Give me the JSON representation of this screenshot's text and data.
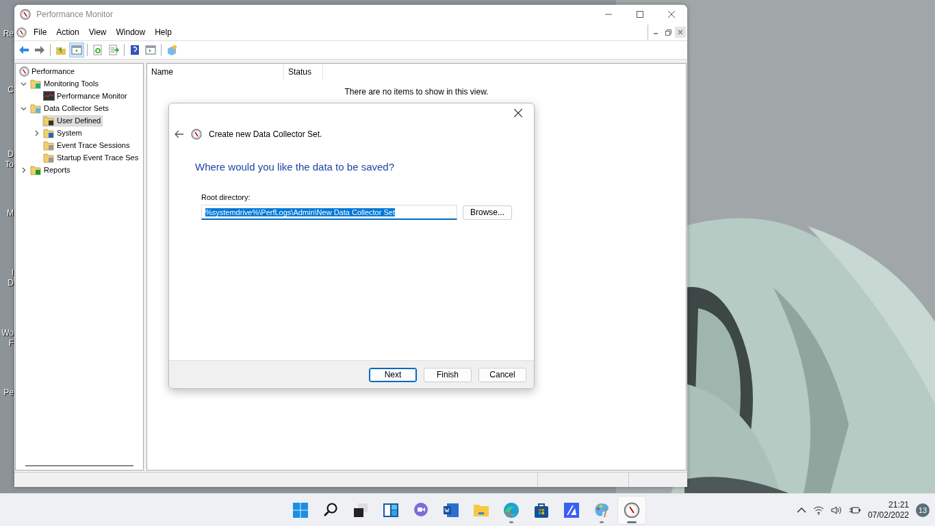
{
  "desktop": {
    "icon_labels": [
      {
        "lines": [
          "Re"
        ]
      },
      {
        "lines": [
          "C"
        ]
      },
      {
        "lines": [
          "D",
          "To"
        ]
      },
      {
        "lines": [
          "M"
        ]
      },
      {
        "lines": [
          "I",
          "D"
        ]
      },
      {
        "lines": [
          "Wo",
          "F"
        ]
      },
      {
        "lines": [
          "Pe"
        ]
      }
    ]
  },
  "window": {
    "title": "Performance Monitor",
    "menu": [
      "File",
      "Action",
      "View",
      "Window",
      "Help"
    ],
    "toolbar": [
      {
        "kind": "back",
        "pressed": false
      },
      {
        "kind": "forward",
        "pressed": false
      },
      {
        "kind": "sep"
      },
      {
        "kind": "up",
        "pressed": false
      },
      {
        "kind": "tree",
        "pressed": true
      },
      {
        "kind": "sep"
      },
      {
        "kind": "refresh",
        "pressed": false
      },
      {
        "kind": "export",
        "pressed": false
      },
      {
        "kind": "sep"
      },
      {
        "kind": "help",
        "pressed": false
      },
      {
        "kind": "pane",
        "pressed": false
      },
      {
        "kind": "sep"
      },
      {
        "kind": "new",
        "pressed": false
      }
    ],
    "tree": {
      "label": "Performance",
      "kind": "gauge",
      "selected": false,
      "children": [
        {
          "label": "Monitoring Tools",
          "kind": "folder-chart",
          "selected": false,
          "expanded": true,
          "children": [
            {
              "label": "Performance Monitor",
              "kind": "chart",
              "selected": false
            }
          ]
        },
        {
          "label": "Data Collector Sets",
          "kind": "folder-cube",
          "selected": false,
          "expanded": true,
          "children": [
            {
              "label": "User Defined",
              "kind": "folder-user",
              "selected": true
            },
            {
              "label": "System",
              "kind": "folder-pc",
              "selected": false,
              "expanded": false
            },
            {
              "label": "Event Trace Sessions",
              "kind": "folder-doc",
              "selected": false
            },
            {
              "label": "Startup Event Trace Ses",
              "kind": "folder-doc",
              "selected": false
            }
          ]
        },
        {
          "label": "Reports",
          "kind": "folder-report",
          "selected": false,
          "expanded": false
        }
      ]
    },
    "list": {
      "columns": [
        "Name",
        "Status"
      ],
      "empty_message": "There are no items to show in this view."
    }
  },
  "dialog": {
    "heading": "Create new Data Collector Set.",
    "question": "Where would you like the data to be saved?",
    "field_label": "Root directory:",
    "field_value": "%systemdrive%\\PerfLogs\\Admin\\New Data Collector Set",
    "browse": "Browse...",
    "buttons": [
      {
        "label": "Next",
        "default": true
      },
      {
        "label": "Finish",
        "default": false
      },
      {
        "label": "Cancel",
        "default": false
      }
    ]
  },
  "taskbar": {
    "apps": [
      {
        "kind": "start",
        "running": false,
        "active": false
      },
      {
        "kind": "search",
        "running": false,
        "active": false
      },
      {
        "kind": "taskview",
        "running": false,
        "active": false
      },
      {
        "kind": "widgets",
        "running": false,
        "active": false
      },
      {
        "kind": "chat",
        "running": false,
        "active": false
      },
      {
        "kind": "word",
        "running": false,
        "active": false
      },
      {
        "kind": "explorer",
        "running": false,
        "active": false
      },
      {
        "kind": "edge",
        "running": true,
        "active": false
      },
      {
        "kind": "store",
        "running": false,
        "active": false
      },
      {
        "kind": "app",
        "running": false,
        "active": false
      },
      {
        "kind": "paint",
        "running": true,
        "active": false
      },
      {
        "kind": "perfmon",
        "running": true,
        "active": true
      }
    ],
    "time": "21:21",
    "date": "07/02/2022",
    "notifications": "13"
  }
}
